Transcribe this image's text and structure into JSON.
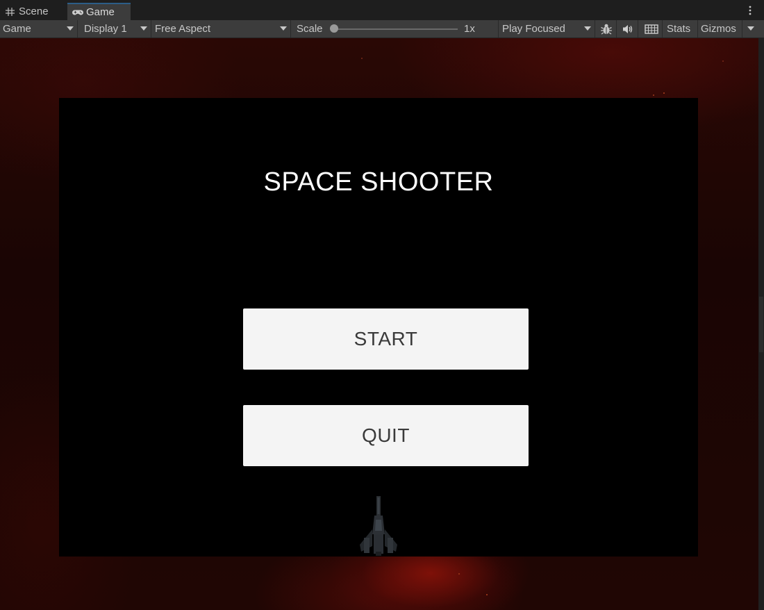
{
  "tabs": [
    {
      "label": "Scene",
      "icon": "grid-hash-icon",
      "active": false
    },
    {
      "label": "Game",
      "icon": "gamepad-icon",
      "active": true
    }
  ],
  "toolbar": {
    "view_dropdown": "Game",
    "display_dropdown": "Display 1",
    "aspect_dropdown": "Free Aspect",
    "scale_label": "Scale",
    "scale_value": "1x",
    "play_mode_dropdown": "Play Focused",
    "stats_button": "Stats",
    "gizmos_button": "Gizmos",
    "icons": [
      "bug-icon",
      "audio-icon",
      "keyboard-grid-icon"
    ]
  },
  "game": {
    "title": "SPACE SHOOTER",
    "start_button": "START",
    "quit_button": "QUIT"
  },
  "colors": {
    "toolbar_bg": "#3c3c3c",
    "tabbar_bg": "#1e1e1e",
    "active_tab_accent": "#2c5d87",
    "panel_bg": "#000000",
    "button_bg": "#f4f4f4",
    "button_text": "#3a3a3a",
    "title_text": "#ffffff"
  }
}
